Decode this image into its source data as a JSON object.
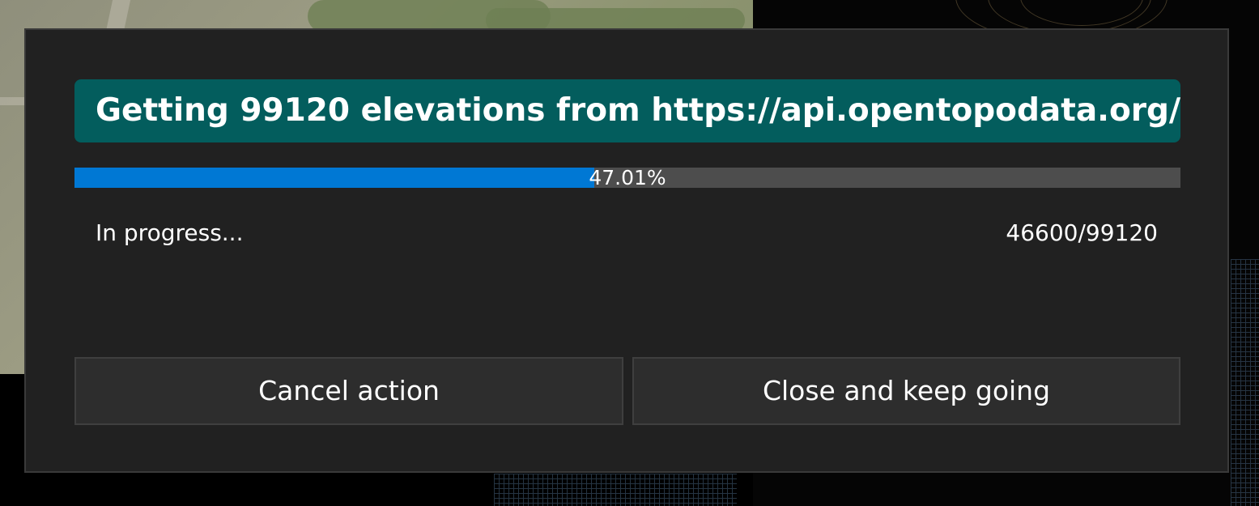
{
  "dialog": {
    "title": "Getting 99120 elevations from https://api.opentopodata.org/",
    "title_bg_color": "#035d5d",
    "progress": {
      "percent_label": "47.01%",
      "fraction": 0.4701,
      "fill_color": "#0078d4",
      "track_color": "#4d4d4d"
    },
    "status": "In progress...",
    "count": "46600/99120",
    "buttons": {
      "cancel_label": "Cancel action",
      "close_label": "Close and keep going"
    }
  }
}
